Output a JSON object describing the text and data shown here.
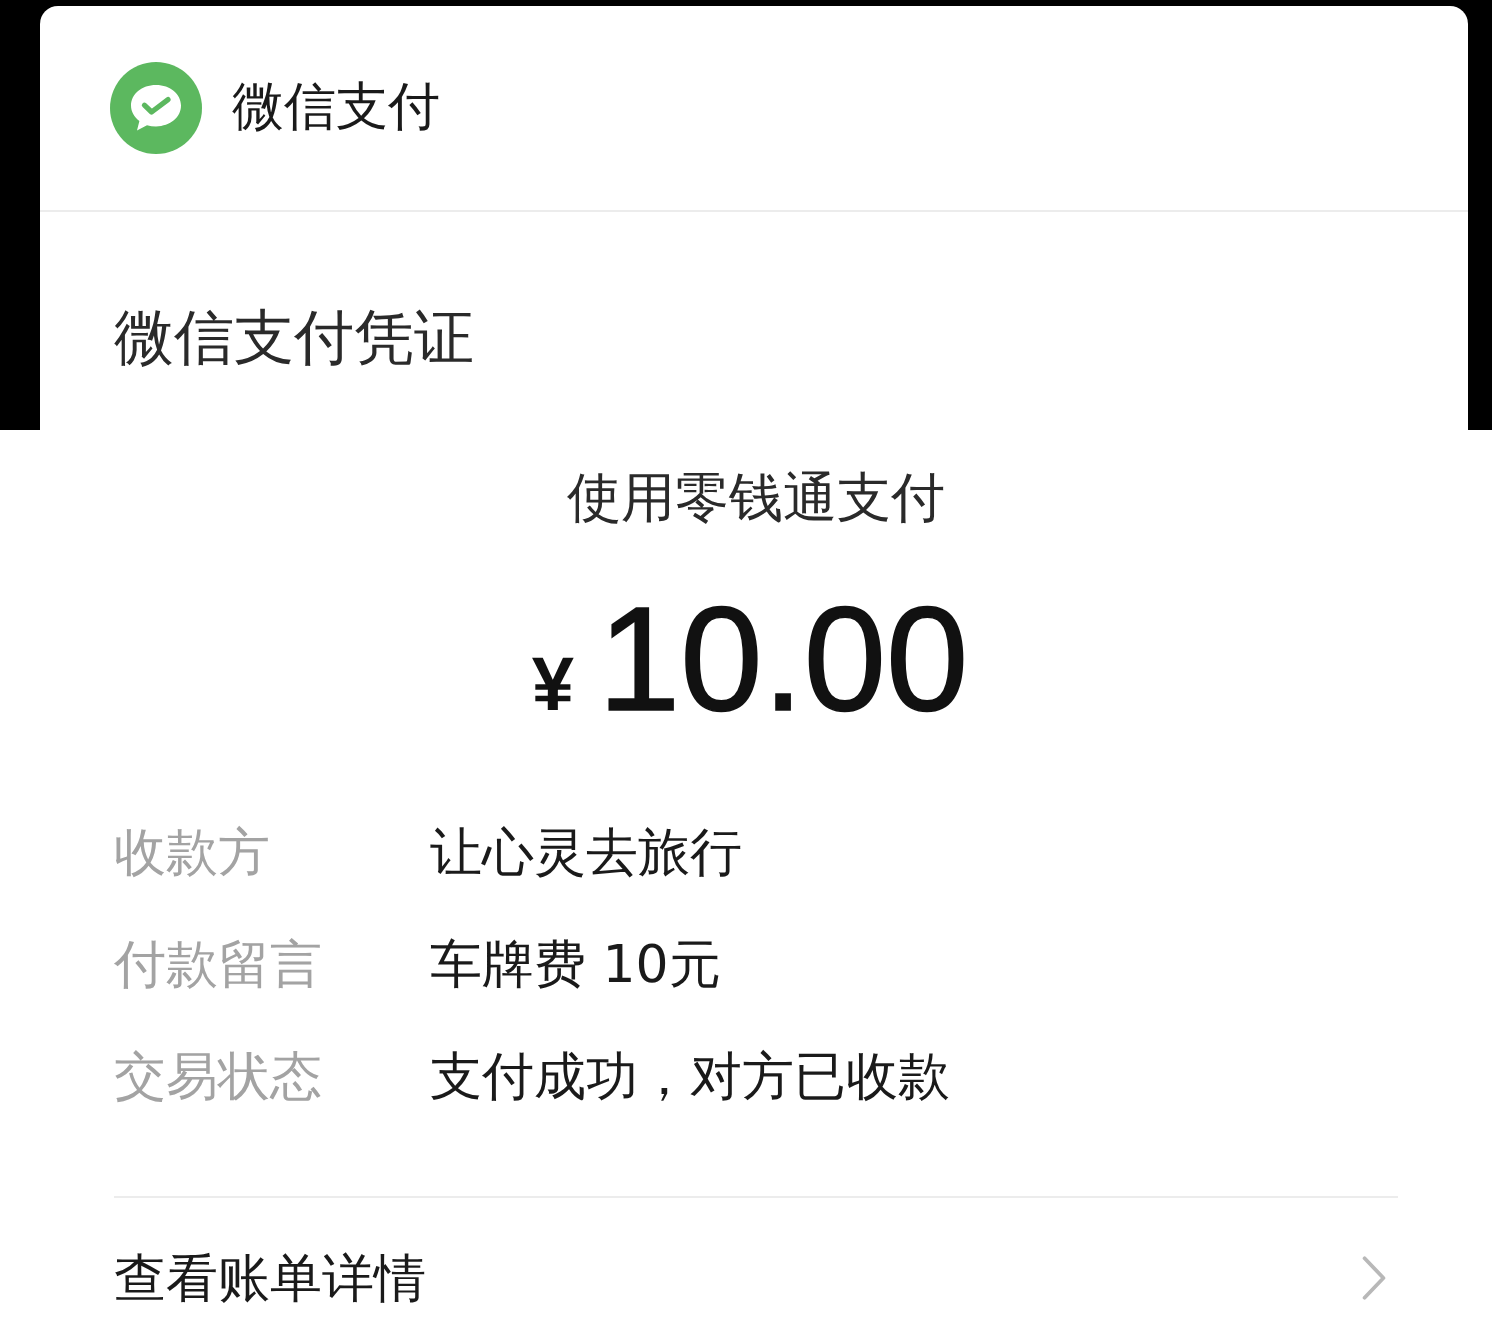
{
  "header": {
    "app_name": "微信支付"
  },
  "receipt": {
    "title": "微信支付凭证",
    "payment_method": "使用零钱通支付",
    "currency": "¥",
    "amount": "10.00"
  },
  "details": [
    {
      "label": "收款方",
      "value": "让心灵去旅行"
    },
    {
      "label": "付款留言",
      "value": "车牌费 10元"
    },
    {
      "label": "交易状态",
      "value": "支付成功，对方已收款"
    }
  ],
  "footer_link": {
    "label": "查看账单详情"
  }
}
